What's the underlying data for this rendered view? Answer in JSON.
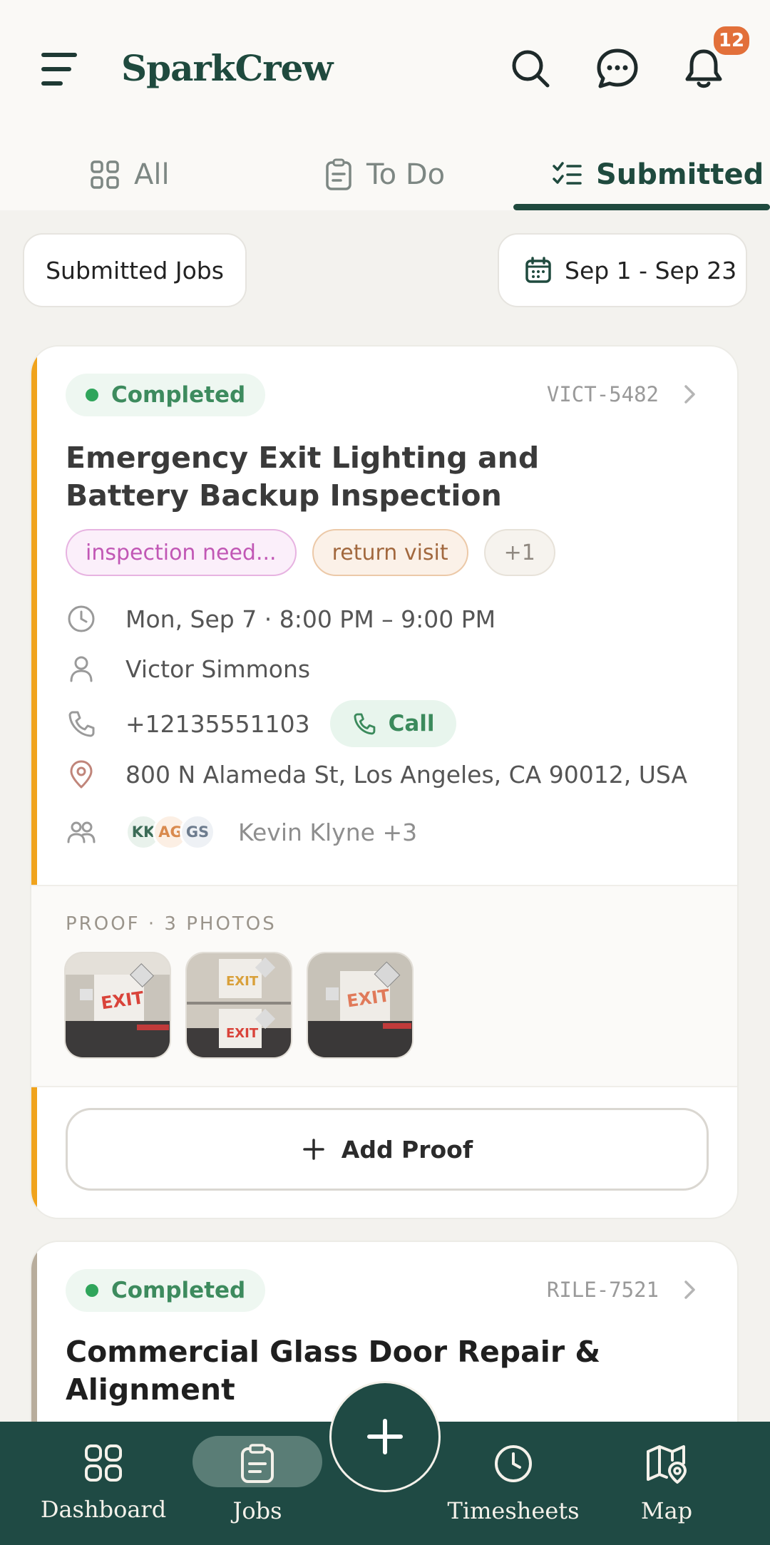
{
  "header": {
    "brand": "SparkCrew",
    "notification_count": "12"
  },
  "tabs": [
    {
      "label": "All",
      "icon": "grid-icon",
      "active": false
    },
    {
      "label": "To Do",
      "icon": "clipboard-icon",
      "active": false
    },
    {
      "label": "Submitted",
      "icon": "checklist-icon",
      "active": true
    }
  ],
  "filters": {
    "status_filter": "Submitted Jobs",
    "date_range": "Sep 1 - Sep 23"
  },
  "jobs": [
    {
      "status": "Completed",
      "id": "VICT-5482",
      "title": "Emergency Exit Lighting and Battery Backup Inspection",
      "tags": [
        "inspection need...",
        "return visit",
        "+1"
      ],
      "schedule": "Mon, Sep 7 · 8:00 PM – 9:00 PM",
      "customer": "Victor Simmons",
      "phone": "+12135551103",
      "call_label": "Call",
      "address": "800 N Alameda St, Los Angeles, CA 90012, USA",
      "crew_initials": [
        "KK",
        "AG",
        "GS"
      ],
      "crew_summary": "Kevin Klyne +3",
      "proof_label": "PROOF · 3 PHOTOS",
      "add_proof_label": "Add Proof"
    },
    {
      "status": "Completed",
      "id": "RILE-7521",
      "title": "Commercial Glass Door Repair & Alignment"
    }
  ],
  "bottom_nav": [
    {
      "label": "Dashboard",
      "icon": "dashboard-icon"
    },
    {
      "label": "Jobs",
      "icon": "jobs-icon",
      "active": true
    },
    {
      "label": "Timesheets",
      "icon": "clock-icon"
    },
    {
      "label": "Map",
      "icon": "map-icon"
    }
  ],
  "colors": {
    "brand": "#1f4a3e",
    "nav_bg": "#1f4a44",
    "badge": "#e2703a",
    "card1_accent": "#f0a31c",
    "card2_accent": "#b8ad9c",
    "status_green": "#3d8b5e"
  }
}
